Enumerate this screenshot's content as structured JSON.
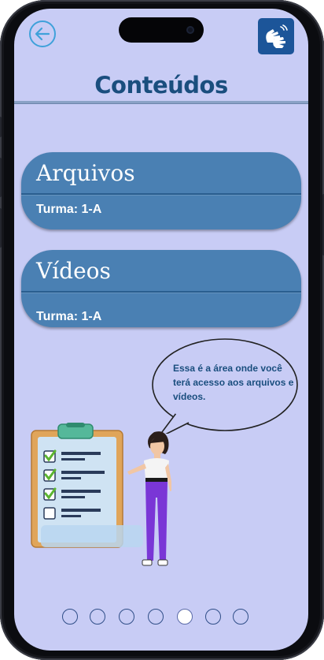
{
  "header": {
    "title": "Conteúdos"
  },
  "cards": [
    {
      "title": "Arquivos",
      "subtitle": "Turma: 1-A"
    },
    {
      "title": "Vídeos",
      "subtitle": "Turma: 1-A"
    }
  ],
  "speech_bubble": {
    "text": "Essa é a área onde você terá acesso aos arquivos e vídeos."
  },
  "icons": {
    "back": "arrow-left-icon",
    "accessibility": "sign-language-icon"
  },
  "pagination": {
    "total": 7,
    "active_index": 4
  },
  "colors": {
    "background": "#c8ccf5",
    "title": "#1a4e7e",
    "card": "#4a80b3",
    "libras_button": "#1c5599"
  }
}
